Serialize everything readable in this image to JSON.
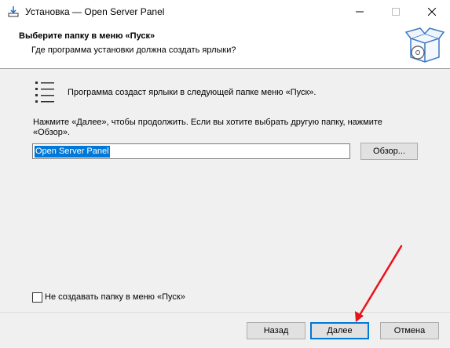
{
  "window": {
    "title": "Установка — Open Server Panel",
    "icon": "installer-icon",
    "controls": [
      "minimize-icon",
      "maximize-icon",
      "close-icon"
    ]
  },
  "header": {
    "title": "Выберите папку в меню «Пуск»",
    "subtitle": "Где программа установки должна создать ярлыки?",
    "image": "install-box-icon"
  },
  "body": {
    "intro": "Программа создаст ярлыки в следующей папке меню «Пуск».",
    "instructions": "Нажмите «Далее», чтобы продолжить. Если вы хотите выбрать другую папку, нажмите «Обзор».",
    "folder_value": "Open Server Panel",
    "browse_label": "Обзор...",
    "no_folder_label": "Не создавать папку в меню «Пуск»",
    "no_folder_checked": false
  },
  "footer": {
    "back_label": "Назад",
    "next_label": "Далее",
    "cancel_label": "Отмена"
  },
  "annotation": {
    "arrow_color": "#e8141b"
  },
  "colors": {
    "accent": "#0078d7",
    "panel": "#f0f0f0"
  }
}
